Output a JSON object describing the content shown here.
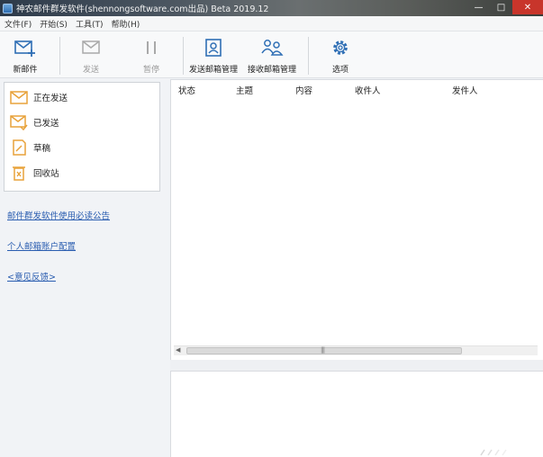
{
  "window": {
    "title": "神农邮件群发软件(shennongsoftware.com出品) Beta 2019.12",
    "controls": {
      "minimize": "—",
      "maximize": "□",
      "close": "✕"
    }
  },
  "menu": [
    {
      "label": "文件(F)"
    },
    {
      "label": "开始(S)"
    },
    {
      "label": "工具(T)"
    },
    {
      "label": "帮助(H)"
    }
  ],
  "toolbar": {
    "new_mail": "新邮件",
    "send": "发送",
    "pause": "暂停",
    "send_mailbox": "发送邮箱管理",
    "receive_mailbox": "接收邮箱管理",
    "options": "选项"
  },
  "folders": [
    {
      "label": "正在发送",
      "icon": "sending-envelope-icon"
    },
    {
      "label": "已发送",
      "icon": "sent-envelope-icon"
    },
    {
      "label": "草稿",
      "icon": "draft-icon"
    },
    {
      "label": "回收站",
      "icon": "trash-icon"
    }
  ],
  "left_links": {
    "notice": "邮件群发软件使用必读公告",
    "account_config": "个人邮箱账户配置",
    "feedback": "<意见反馈>"
  },
  "table": {
    "columns": [
      "状态",
      "主题",
      "内容",
      "收件人",
      "发件人"
    ]
  },
  "colors": {
    "accent_blue": "#2f6fb5",
    "icon_orange": "#e8a23a",
    "link_blue": "#2a5db0",
    "close_red": "#c8352b"
  }
}
